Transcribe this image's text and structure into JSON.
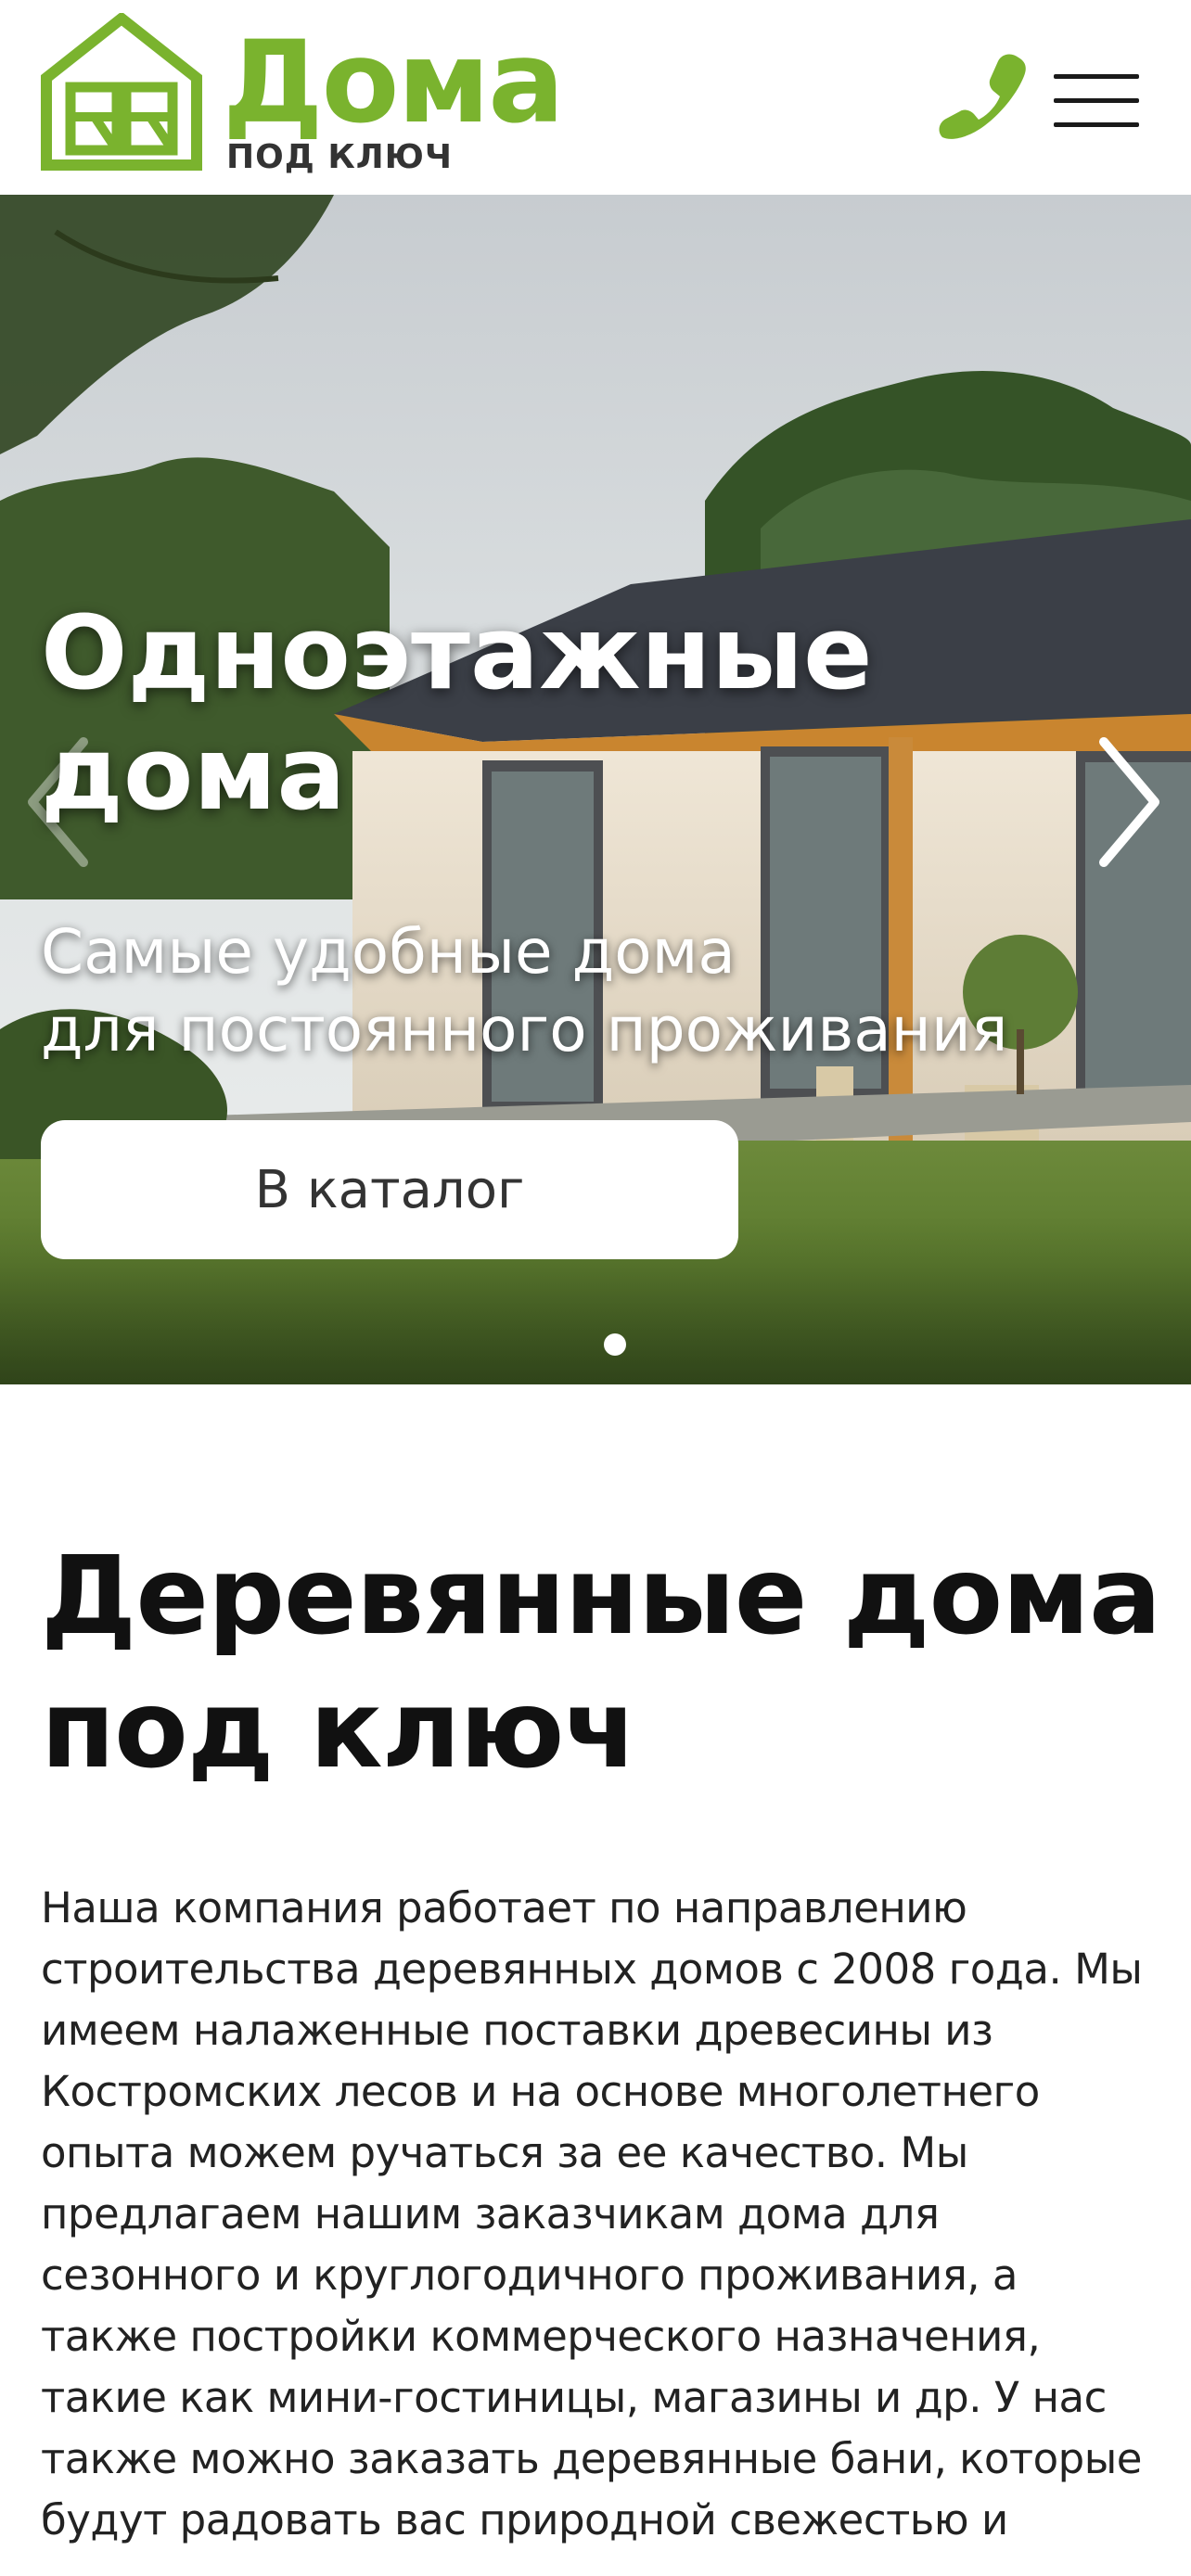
{
  "header": {
    "logo_word": "Дома",
    "logo_sub": "ПОД КЛЮЧ",
    "brand_color": "#7ab32e",
    "phone_icon": "phone-icon",
    "menu_icon": "hamburger-menu-icon"
  },
  "hero": {
    "title_line1": "Одноэтажные",
    "title_line2": "дома",
    "subtitle_line1": "Самые удобные дома",
    "subtitle_line2": "для постоянного проживания",
    "cta_label": "В каталог",
    "prev_icon": "chevron-left-icon",
    "next_icon": "chevron-right-icon",
    "slides_count": 1,
    "active_slide": 1
  },
  "content": {
    "title_line1": "Деревянные дома",
    "title_line2": "под ключ",
    "text": "Наша компания работает по направлению\nстроительства деревянных домов с 2008 года. Мы\nимеем налаженные поставки древесины из\nКостромских лесов и на основе многолетнего\nопыта можем ручаться за ее качество. Мы\nпредлагаем нашим заказчикам дома для\nсезонного и круглогодичного проживания, а\nтакже постройки коммерческого назначения,\nтакие как мини-гостиницы, магазины и др. У нас\nтакже можно заказать деревянные бани, которые\nбудут радовать вас природной свежестью и"
  }
}
